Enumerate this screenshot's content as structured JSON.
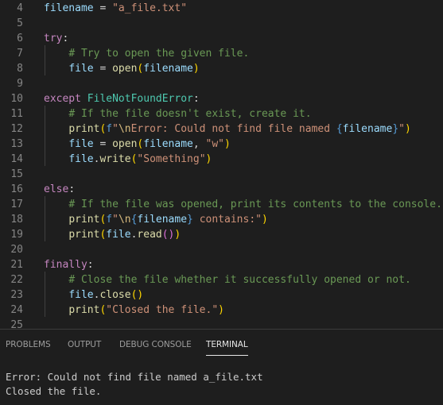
{
  "editor": {
    "colors": {
      "plain": "#d4d4d4",
      "keyword": "#c586c0",
      "builtin": "#dcdcaa",
      "variable": "#9cdcfe",
      "class": "#4ec9b0",
      "string": "#ce9178",
      "comment": "#6a9955",
      "escape": "#d7ba7d"
    },
    "lines": [
      {
        "n": "4",
        "tokens": [
          [
            "var",
            "filename"
          ],
          [
            "plain",
            " = "
          ],
          [
            "string",
            "\"a_file.txt\""
          ]
        ]
      },
      {
        "n": "5",
        "tokens": []
      },
      {
        "n": "6",
        "tokens": [
          [
            "keyword",
            "try"
          ],
          [
            "plain",
            ":"
          ]
        ]
      },
      {
        "n": "7",
        "tokens": [
          [
            "plain",
            "    "
          ],
          [
            "comment",
            "# Try to open the given file."
          ]
        ]
      },
      {
        "n": "8",
        "tokens": [
          [
            "plain",
            "    "
          ],
          [
            "var",
            "file"
          ],
          [
            "plain",
            " = "
          ],
          [
            "builtin",
            "open"
          ],
          [
            "paren1",
            "("
          ],
          [
            "var",
            "filename"
          ],
          [
            "paren1",
            ")"
          ]
        ]
      },
      {
        "n": "9",
        "tokens": []
      },
      {
        "n": "10",
        "tokens": [
          [
            "keyword",
            "except"
          ],
          [
            "plain",
            " "
          ],
          [
            "class",
            "FileNotFoundError"
          ],
          [
            "plain",
            ":"
          ]
        ]
      },
      {
        "n": "11",
        "tokens": [
          [
            "plain",
            "    "
          ],
          [
            "comment",
            "# If the file doesn't exist, create it."
          ]
        ]
      },
      {
        "n": "12",
        "tokens": [
          [
            "plain",
            "    "
          ],
          [
            "builtin",
            "print"
          ],
          [
            "paren1",
            "("
          ],
          [
            "brace",
            "f"
          ],
          [
            "string",
            "\""
          ],
          [
            "escape",
            "\\n"
          ],
          [
            "string",
            "Error: Could not find file named "
          ],
          [
            "brace",
            "{"
          ],
          [
            "var",
            "filename"
          ],
          [
            "brace",
            "}"
          ],
          [
            "string",
            "\""
          ],
          [
            "paren1",
            ")"
          ]
        ]
      },
      {
        "n": "13",
        "tokens": [
          [
            "plain",
            "    "
          ],
          [
            "var",
            "file"
          ],
          [
            "plain",
            " = "
          ],
          [
            "builtin",
            "open"
          ],
          [
            "paren1",
            "("
          ],
          [
            "var",
            "filename"
          ],
          [
            "plain",
            ", "
          ],
          [
            "string",
            "\"w\""
          ],
          [
            "paren1",
            ")"
          ]
        ]
      },
      {
        "n": "14",
        "tokens": [
          [
            "plain",
            "    "
          ],
          [
            "var",
            "file"
          ],
          [
            "plain",
            "."
          ],
          [
            "builtin",
            "write"
          ],
          [
            "paren1",
            "("
          ],
          [
            "string",
            "\"Something\""
          ],
          [
            "paren1",
            ")"
          ]
        ]
      },
      {
        "n": "15",
        "tokens": []
      },
      {
        "n": "16",
        "tokens": [
          [
            "keyword",
            "else"
          ],
          [
            "plain",
            ":"
          ]
        ]
      },
      {
        "n": "17",
        "tokens": [
          [
            "plain",
            "    "
          ],
          [
            "comment",
            "# If the file was opened, print its contents to the console."
          ]
        ]
      },
      {
        "n": "18",
        "tokens": [
          [
            "plain",
            "    "
          ],
          [
            "builtin",
            "print"
          ],
          [
            "paren1",
            "("
          ],
          [
            "brace",
            "f"
          ],
          [
            "string",
            "\""
          ],
          [
            "escape",
            "\\n"
          ],
          [
            "brace",
            "{"
          ],
          [
            "var",
            "filename"
          ],
          [
            "brace",
            "}"
          ],
          [
            "string",
            " contains:\""
          ],
          [
            "paren1",
            ")"
          ]
        ]
      },
      {
        "n": "19",
        "tokens": [
          [
            "plain",
            "    "
          ],
          [
            "builtin",
            "print"
          ],
          [
            "paren1",
            "("
          ],
          [
            "var",
            "file"
          ],
          [
            "plain",
            "."
          ],
          [
            "builtin",
            "read"
          ],
          [
            "paren2",
            "()"
          ],
          [
            "paren1",
            ")"
          ]
        ]
      },
      {
        "n": "20",
        "tokens": []
      },
      {
        "n": "21",
        "tokens": [
          [
            "keyword",
            "finally"
          ],
          [
            "plain",
            ":"
          ]
        ]
      },
      {
        "n": "22",
        "tokens": [
          [
            "plain",
            "    "
          ],
          [
            "comment",
            "# Close the file whether it successfully opened or not."
          ]
        ]
      },
      {
        "n": "23",
        "tokens": [
          [
            "plain",
            "    "
          ],
          [
            "var",
            "file"
          ],
          [
            "plain",
            "."
          ],
          [
            "builtin",
            "close"
          ],
          [
            "paren1",
            "()"
          ]
        ]
      },
      {
        "n": "24",
        "tokens": [
          [
            "plain",
            "    "
          ],
          [
            "builtin",
            "print"
          ],
          [
            "paren1",
            "("
          ],
          [
            "string",
            "\"Closed the file.\""
          ],
          [
            "paren1",
            ")"
          ]
        ]
      },
      {
        "n": "25",
        "tokens": []
      }
    ]
  },
  "panel": {
    "tabs": [
      {
        "label": "PROBLEMS",
        "active": false
      },
      {
        "label": "OUTPUT",
        "active": false
      },
      {
        "label": "DEBUG CONSOLE",
        "active": false
      },
      {
        "label": "TERMINAL",
        "active": true
      }
    ],
    "terminal_lines": [
      "Error: Could not find file named a_file.txt",
      "Closed the file."
    ]
  }
}
